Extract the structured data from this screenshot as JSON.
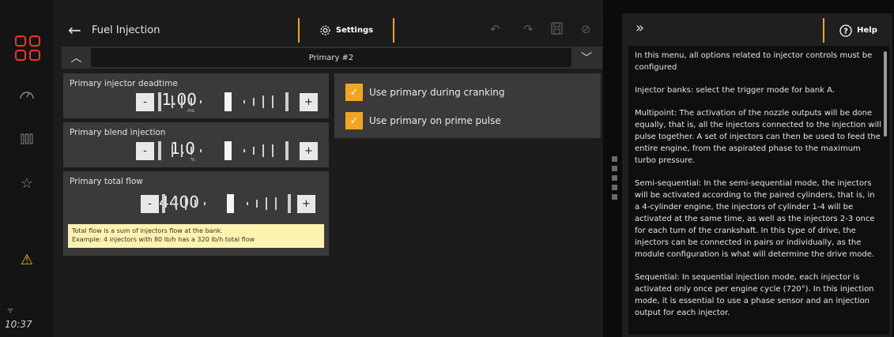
{
  "window": {
    "title": "Fuel Injection",
    "clock": "10:37"
  },
  "toolbar": {
    "settings_label": "Settings"
  },
  "bank": {
    "selected": "Primary #2"
  },
  "fields": [
    {
      "label": "Primary injector deadtime",
      "value": "1.00",
      "unit": "ms",
      "minus": "-",
      "plus": "+"
    },
    {
      "label": "Primary blend injection",
      "value": "1.0",
      "unit": "%",
      "minus": "-",
      "plus": "+"
    },
    {
      "label": "Primary total flow",
      "value": "4400",
      "unit": "",
      "minus": "-",
      "plus": "+",
      "info": [
        "Total flow is a sum of injectors flow at the bank.",
        "Example: 4 injectors with 80 lb/h has a 320 lb/h total flow"
      ]
    }
  ],
  "options": [
    {
      "label": "Use primary during cranking",
      "checked": true
    },
    {
      "label": "Use primary on prime pulse",
      "checked": true
    }
  ],
  "help": {
    "button_label": "Help",
    "paragraphs": [
      "In this menu, all options related to injector controls must be configured",
      "Injector banks: select the trigger mode for bank A.",
      "Multipoint: The activation of the nozzle outputs will be done equally, that is, all the injectors connected to the injection will pulse together. A set of injectors can then be used to feed the entire engine, from the aspirated phase to the maximum turbo pressure.",
      "Semi-sequential: In the semi-sequential mode, the injectors will be activated according to the paired cylinders, that is, in a 4-cylinder engine, the injectors of cylinder 1-4 will be activated at the same time, as well as the injectors 2-3 once for each turn of the crankshaft. In this type of drive, the injectors can be connected in pairs or individually, as the module configuration is what will determine the drive mode.",
      "Sequential: In sequential injection mode, each injector is activated only once per engine cycle (720°). In this injection mode, it is essential to use a phase sensor and an injection output for each injector."
    ]
  },
  "colors": {
    "accent": "#f0a622",
    "logo": "#e63a28",
    "warning": "#f0c419",
    "info_bg": "#fdf3b0"
  },
  "icons": {
    "nav": [
      "dashboard-logo-icon",
      "gauge-icon",
      "injectors-icon",
      "star-icon",
      "warning-icon",
      "wifi-icon"
    ],
    "toolbar": [
      "back-arrow-icon",
      "gear-icon",
      "undo-icon",
      "redo-icon",
      "save-icon",
      "disable-icon"
    ]
  }
}
